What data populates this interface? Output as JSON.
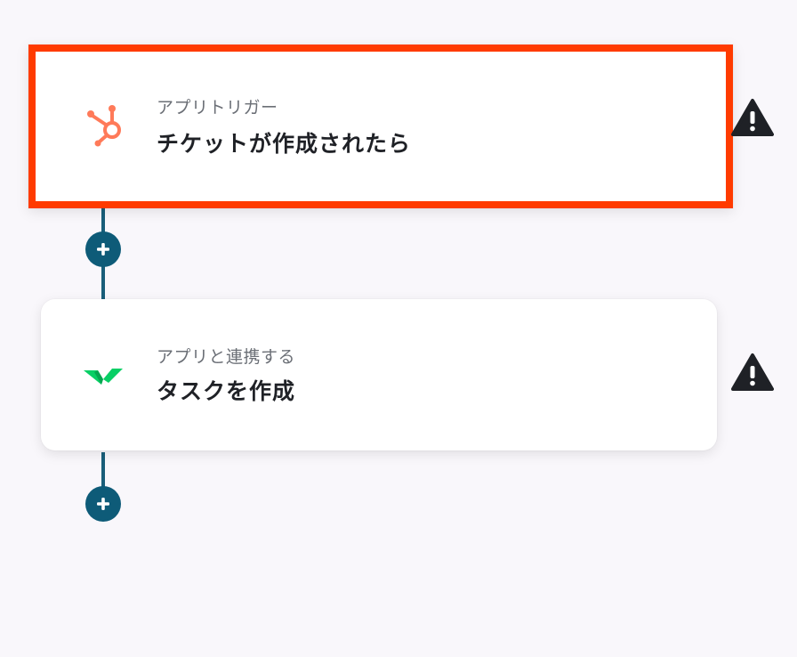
{
  "flow": {
    "steps": [
      {
        "subtitle": "アプリトリガー",
        "title": "チケットが作成されたら",
        "icon": "hubspot-icon",
        "icon_color": "#ff7a59",
        "selected": true,
        "warning": true
      },
      {
        "subtitle": "アプリと連携する",
        "title": "タスクを作成",
        "icon": "wrike-icon",
        "icon_color": "#08cf65",
        "selected": false,
        "warning": true
      }
    ],
    "add_buttons": [
      {
        "icon": "plus-icon"
      },
      {
        "icon": "plus-icon"
      }
    ]
  },
  "colors": {
    "background": "#f9f7fb",
    "selection_border": "#ff3b00",
    "connector": "#1a5f7a",
    "add_button": "#0e5b78",
    "warning": "#1f2126"
  }
}
